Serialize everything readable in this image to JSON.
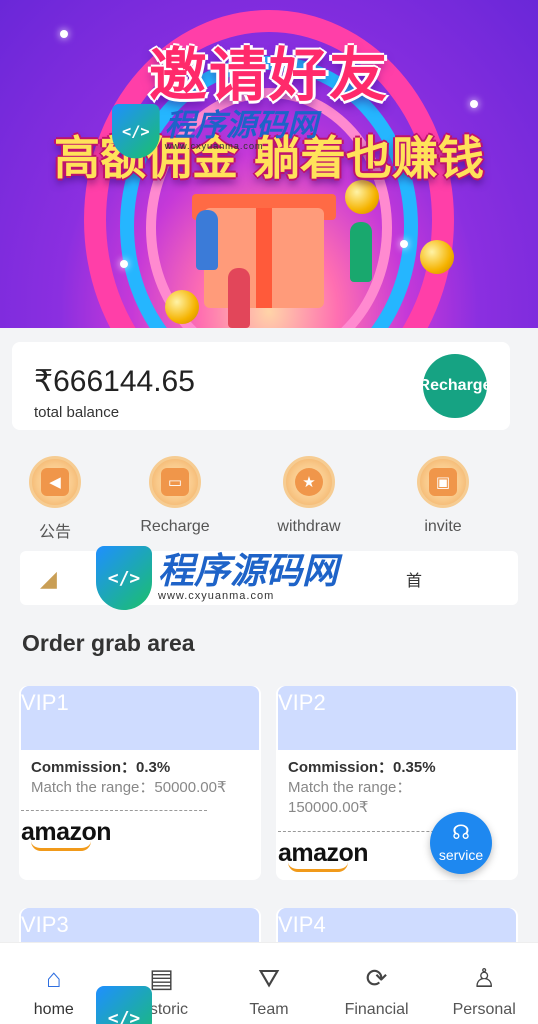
{
  "banner": {
    "title": "邀请好友",
    "subtitle": "高额佣金 躺着也赚钱"
  },
  "watermark": {
    "brand": "程序源码网",
    "url": "www.cxyuanma.com"
  },
  "balance": {
    "amount": "₹666144.65",
    "label": "total balance",
    "recharge_label": "Recharge"
  },
  "quick_actions": [
    {
      "label": "公告",
      "icon": "announcement-icon"
    },
    {
      "label": "Recharge",
      "icon": "wallet-icon"
    },
    {
      "label": "withdraw",
      "icon": "medal-icon"
    },
    {
      "label": "invite",
      "icon": "gift-box-icon"
    }
  ],
  "notice": {
    "text": "首",
    "icon": "speaker-icon"
  },
  "order_section": {
    "title": "Order grab area"
  },
  "vip_cards": [
    {
      "name": "VIP1",
      "commission": "Commission：0.3%",
      "range": "Match the range：50000.00₹",
      "brand": "amazon"
    },
    {
      "name": "VIP2",
      "commission": "Commission：0.35%",
      "range_line1": "Match the range：",
      "range_line2": "150000.00₹",
      "brand": "amazon"
    },
    {
      "name": "VIP3"
    },
    {
      "name": "VIP4"
    }
  ],
  "service": {
    "label": "service",
    "icon": "headset-icon"
  },
  "tabbar": {
    "items": [
      {
        "label": "home",
        "icon": "home-icon",
        "active": true
      },
      {
        "label": "Historic",
        "icon": "clipboard-icon",
        "active": false
      },
      {
        "label": "Team",
        "icon": "team-icon",
        "active": false
      },
      {
        "label": "Financial",
        "icon": "coin-cycle-icon",
        "active": false
      },
      {
        "label": "Personal",
        "icon": "person-icon",
        "active": false
      }
    ]
  },
  "colors": {
    "accent_blue": "#2f6fe0",
    "recharge_green": "#16a383",
    "vip_header": "#cfdcff",
    "service_blue": "#1e88f0"
  }
}
